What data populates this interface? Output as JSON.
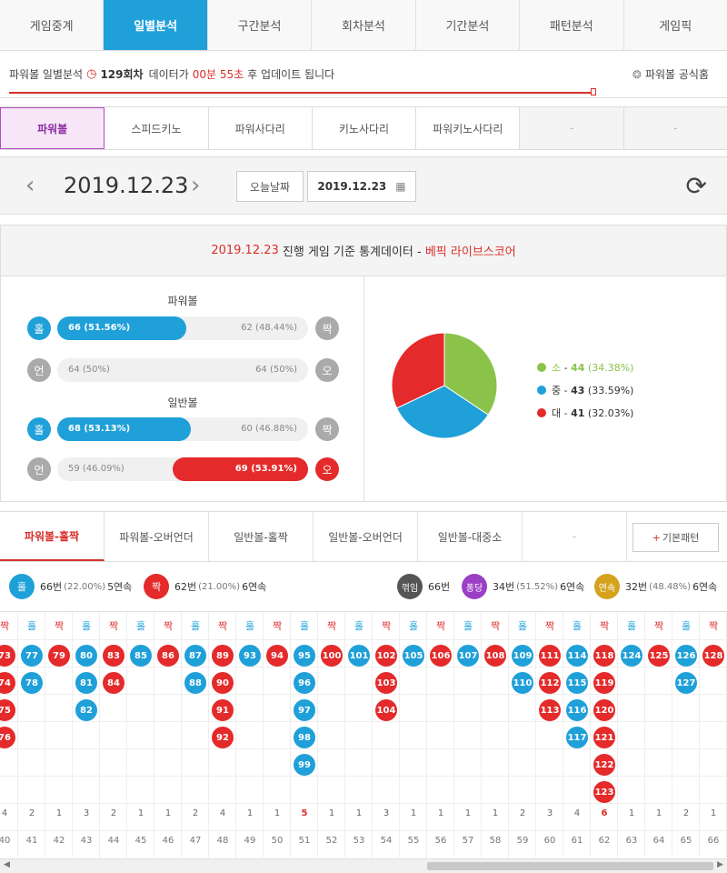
{
  "top_tabs": [
    "게임중계",
    "일별분석",
    "구간분석",
    "회차분석",
    "기간분석",
    "패턴분석",
    "게임픽"
  ],
  "info": {
    "prefix": "파워볼 일별분석",
    "round": "129회차",
    "mid": "데이터가",
    "time": "00분 55초",
    "suffix": "후 업데이트 됩니다",
    "home": "파워볼 공식홈"
  },
  "games": [
    "파워볼",
    "스피드키노",
    "파워사다리",
    "키노사다리",
    "파워키노사다리",
    "-",
    "-"
  ],
  "date": {
    "current": "2019.12.23",
    "today_btn": "오늘날짜",
    "picker": "2019.12.23"
  },
  "stats_header": {
    "date": "2019.12.23",
    "text": "진행 게임 기준 통계데이터 -",
    "source": "베픽 라이브스코어"
  },
  "powerball": {
    "title": "파워볼",
    "odd_label": "홀",
    "even_label": "짝",
    "under_label": "언",
    "over_label": "오",
    "odd": "66 (51.56%)",
    "even": "62 (48.44%)",
    "odd_frac": 0.5156,
    "under": "64 (50%)",
    "over": "64 (50%)"
  },
  "normalball": {
    "title": "일반볼",
    "odd_label": "홀",
    "even_label": "짝",
    "under_label": "언",
    "over_label": "오",
    "odd": "68 (53.13%)",
    "even": "60 (46.88%)",
    "odd_frac": 0.5313,
    "under": "59 (46.09%)",
    "over": "69 (53.91%)",
    "over_frac": 0.5391
  },
  "chart_data": {
    "type": "pie",
    "slices": [
      {
        "label": "소",
        "value": 44,
        "pct": "(34.38%)",
        "color": "#8bc34a"
      },
      {
        "label": "중",
        "value": 43,
        "pct": "(33.59%)",
        "color": "#1fa0d9"
      },
      {
        "label": "대",
        "value": 41,
        "pct": "(32.03%)",
        "color": "#e42a2a"
      }
    ]
  },
  "pattern_tabs": [
    "파워볼-홀짝",
    "파워볼-오버언더",
    "일반볼-홀짝",
    "일반볼-오버언더",
    "일반볼-대중소",
    "-"
  ],
  "basic_pattern": "기본패턴",
  "summary": {
    "odd": {
      "icon": "홀",
      "count": "66번",
      "pct": "(22.00%)",
      "streak": "5연속"
    },
    "even": {
      "icon": "짝",
      "count": "62번",
      "pct": "(21.00%)",
      "streak": "6연속"
    },
    "bend": {
      "icon": "꺾임",
      "count": "66번"
    },
    "pong": {
      "icon": "퐁당",
      "count": "34번",
      "pct": "(51.52%)",
      "streak": "6연속"
    },
    "cont": {
      "icon": "연속",
      "count": "32번",
      "pct": "(48.48%)",
      "streak": "6연속"
    }
  },
  "pattern_columns": [
    {
      "type": "짝",
      "balls": [
        "73",
        "74",
        "75",
        "76"
      ],
      "count": "4",
      "round": "40"
    },
    {
      "type": "홀",
      "balls": [
        "77",
        "78"
      ],
      "count": "2",
      "round": "41"
    },
    {
      "type": "짝",
      "balls": [
        "79"
      ],
      "count": "1",
      "round": "42"
    },
    {
      "type": "홀",
      "balls": [
        "80",
        "81",
        "82"
      ],
      "count": "3",
      "round": "43"
    },
    {
      "type": "짝",
      "balls": [
        "83",
        "84"
      ],
      "count": "2",
      "round": "44"
    },
    {
      "type": "홀",
      "balls": [
        "85"
      ],
      "count": "1",
      "round": "45"
    },
    {
      "type": "짝",
      "balls": [
        "86"
      ],
      "count": "1",
      "round": "46"
    },
    {
      "type": "홀",
      "balls": [
        "87",
        "88"
      ],
      "count": "2",
      "round": "47"
    },
    {
      "type": "짝",
      "balls": [
        "89",
        "90",
        "91",
        "92"
      ],
      "count": "4",
      "round": "48"
    },
    {
      "type": "홀",
      "balls": [
        "93"
      ],
      "count": "1",
      "round": "49"
    },
    {
      "type": "짝",
      "balls": [
        "94"
      ],
      "count": "1",
      "round": "50"
    },
    {
      "type": "홀",
      "balls": [
        "95",
        "96",
        "97",
        "98",
        "99"
      ],
      "count": "5",
      "round": "51"
    },
    {
      "type": "짝",
      "balls": [
        "100"
      ],
      "count": "1",
      "round": "52"
    },
    {
      "type": "홀",
      "balls": [
        "101"
      ],
      "count": "1",
      "round": "53"
    },
    {
      "type": "짝",
      "balls": [
        "102",
        "103",
        "104"
      ],
      "count": "3",
      "round": "54"
    },
    {
      "type": "홀",
      "balls": [
        "105"
      ],
      "count": "1",
      "round": "55"
    },
    {
      "type": "짝",
      "balls": [
        "106"
      ],
      "count": "1",
      "round": "56"
    },
    {
      "type": "홀",
      "balls": [
        "107"
      ],
      "count": "1",
      "round": "57"
    },
    {
      "type": "짝",
      "balls": [
        "108"
      ],
      "count": "1",
      "round": "58"
    },
    {
      "type": "홀",
      "balls": [
        "109",
        "110"
      ],
      "count": "2",
      "round": "59"
    },
    {
      "type": "짝",
      "balls": [
        "111",
        "112",
        "113"
      ],
      "count": "3",
      "round": "60"
    },
    {
      "type": "홀",
      "balls": [
        "114",
        "115",
        "116",
        "117"
      ],
      "count": "4",
      "round": "61"
    },
    {
      "type": "짝",
      "balls": [
        "118",
        "119",
        "120",
        "121",
        "122",
        "123"
      ],
      "count": "6",
      "round": "62"
    },
    {
      "type": "홀",
      "balls": [
        "124"
      ],
      "count": "1",
      "round": "63"
    },
    {
      "type": "짝",
      "balls": [
        "125"
      ],
      "count": "1",
      "round": "64"
    },
    {
      "type": "홀",
      "balls": [
        "126",
        "127"
      ],
      "count": "2",
      "round": "65"
    },
    {
      "type": "짝",
      "balls": [
        "128"
      ],
      "count": "1",
      "round": "66"
    }
  ],
  "highlight_rounds": [
    "51",
    "62"
  ]
}
